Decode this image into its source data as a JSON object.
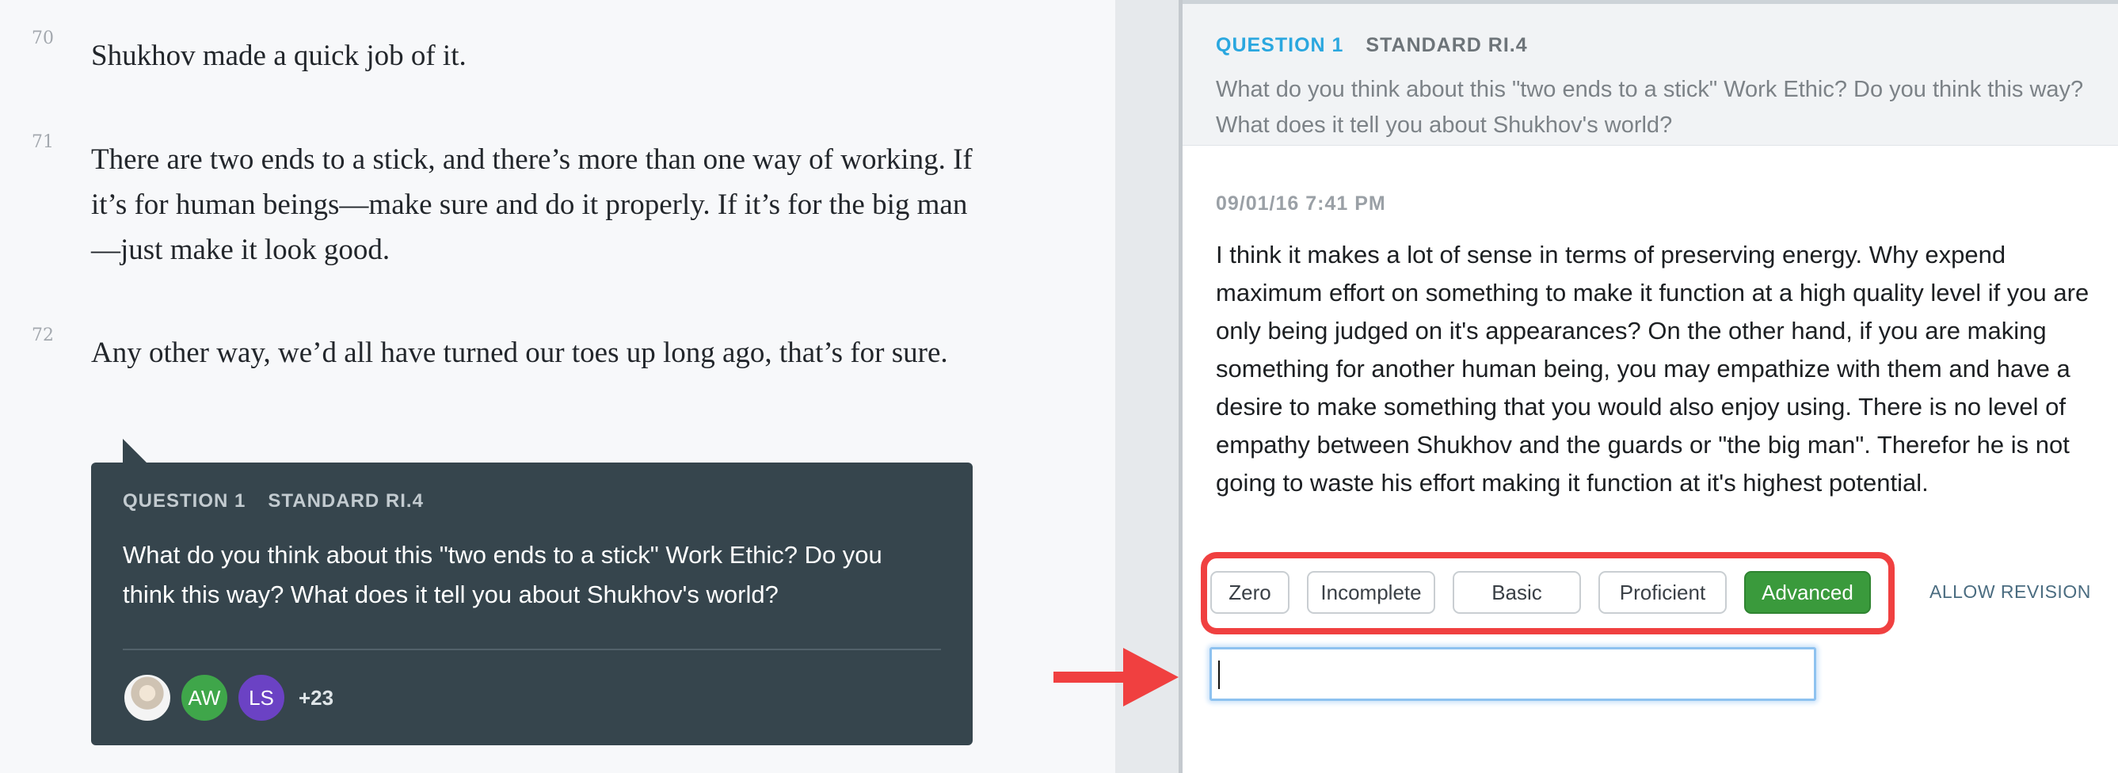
{
  "reader": {
    "paragraphs": [
      {
        "num": "70",
        "text": "Shukhov made a quick job of it."
      },
      {
        "num": "71",
        "text": "There are two ends to a stick, and there’s more than one way of working. If it’s for human beings—make sure and do it properly. If it’s for the big man—just make it look good."
      },
      {
        "num": "72",
        "text": "Any other way, we’d all have turned our toes up long ago, that’s for sure."
      }
    ],
    "question_card": {
      "question_label": "QUESTION 1",
      "standard_label": "STANDARD RI.4",
      "prompt": "What do you think about this  \"two ends to a stick\" Work Ethic?  Do you think this way?  What does it tell you about Shukhov's world?",
      "avatars": [
        "",
        "AW",
        "LS"
      ],
      "more_count": "+23"
    }
  },
  "panel": {
    "question_label": "QUESTION 1",
    "standard_label": "STANDARD RI.4",
    "prompt": "What do you think about this  \"two ends to a stick\" Work Ethic?  Do you think this way?  What does it tell you about Shukhov's world?",
    "timestamp": "09/01/16 7:41 PM",
    "answer": "I think it makes a lot of sense in terms of preserving energy. Why expend maximum effort on something to make it function at a high quality level if you are only being judged on it's appearances? On the other hand, if you are making something for another human being, you may empathize with them and have a desire to make something that you would also enjoy using. There is no level of empathy between Shukhov and the guards or \"the big man\". Therefor he is not going to waste his effort making it function at it's highest potential.",
    "rubric": [
      "Zero",
      "Incomplete",
      "Basic",
      "Proficient",
      "Advanced"
    ],
    "selected_rubric": "Advanced",
    "allow_revision": "ALLOW REVISION",
    "feedback_value": ""
  },
  "colors": {
    "accent_blue": "#2aa7df",
    "advanced_green": "#3a9a3c",
    "highlight_red": "#f04040",
    "card_dark": "#36454d"
  }
}
